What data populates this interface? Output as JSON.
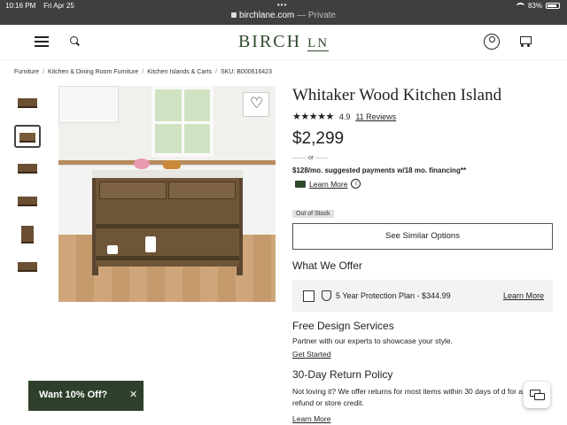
{
  "status": {
    "time": "10:16 PM",
    "date": "Fri Apr 25",
    "battery": "83%",
    "dots": "•••"
  },
  "url": {
    "domain": "birchlane.com",
    "suffix": "— Private"
  },
  "brand": {
    "logo_main": "BIRCH ",
    "logo_ln": "LN"
  },
  "breadcrumb": [
    "Furniture",
    "Kitchen & Dining Room Furniture",
    "Kitchen Islands & Carts",
    "SKU: B000616423"
  ],
  "product": {
    "title": "Whitaker Wood Kitchen Island",
    "stars": "★★★★★",
    "rating": "4.9",
    "reviews": "11 Reviews",
    "price": "$2,299",
    "or": "or",
    "financing": "$128/mo. suggested payments w/18 mo. financing**",
    "learn_more": "Learn More",
    "info_glyph": "i",
    "stock": "Out of Stock",
    "similar_button": "See Similar Options"
  },
  "offer": {
    "heading": "What We Offer",
    "protection": "5 Year Protection Plan - $344.99",
    "protection_link": "Learn More"
  },
  "design": {
    "heading": "Free Design Services",
    "text": "Partner with our experts to showcase your style.",
    "link": "Get Started"
  },
  "returns": {
    "heading": "30-Day Return Policy",
    "text": "Not loving it? We offer returns for most items within 30 days of d for a refund or store credit.",
    "link": "Learn More"
  },
  "promo": {
    "label": "Want 10% Off?",
    "close": "✕"
  },
  "colors": {
    "brand": "#2e4a2e",
    "promo_bg": "#2e3f2a"
  }
}
